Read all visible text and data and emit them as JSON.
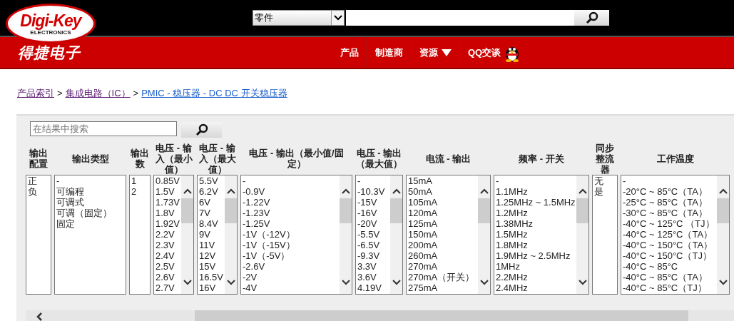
{
  "logo": {
    "brand": "Digi-Key",
    "subtitle": "ELECTRONICS",
    "local_name": "得捷电子"
  },
  "search": {
    "category": "零件"
  },
  "nav": [
    {
      "label": "产品",
      "kind": "plain"
    },
    {
      "label": "制造商",
      "kind": "plain"
    },
    {
      "label": "资源",
      "kind": "dropdown"
    },
    {
      "label": "QQ交谈",
      "kind": "chat"
    }
  ],
  "breadcrumb": [
    {
      "label": "产品索引",
      "visited": true
    },
    {
      "label": "集成电路（IC）",
      "visited": true
    },
    {
      "label": "PMIC - 稳压器 - DC DC 开关稳压器",
      "visited": false
    }
  ],
  "separator": ">",
  "filter": {
    "placeholder": "在结果中搜索"
  },
  "columns": [
    {
      "header": "输出配置",
      "scrollable": false,
      "options": [
        "正",
        "负"
      ]
    },
    {
      "header": "输出类型",
      "scrollable": false,
      "options": [
        "-",
        "可编程",
        "可调式",
        "可调（固定）",
        "固定"
      ]
    },
    {
      "header": "输出数",
      "scrollable": false,
      "options": [
        "1",
        "2"
      ]
    },
    {
      "header": "电压 - 输入（最小值）",
      "scrollable": true,
      "options": [
        "0.85V",
        "1.5V",
        "1.73V",
        "1.8V",
        "1.92V",
        "2.2V",
        "2.3V",
        "2.4V",
        "2.5V",
        "2.6V",
        "2.7V"
      ]
    },
    {
      "header": "电压 - 输入（最大值）",
      "scrollable": true,
      "options": [
        "5.5V",
        "6.2V",
        "6V",
        "7V",
        "8.4V",
        "9V",
        "11V",
        "12V",
        "15V",
        "16.5V",
        "16V"
      ]
    },
    {
      "header": "电压 - 输出（最小值/固定）",
      "scrollable": true,
      "options": [
        "-",
        "-0.9V",
        "-1.22V",
        "-1.23V",
        "-1.25V",
        "-1V（-12V）",
        "-1V（-15V）",
        "-1V（-5V）",
        "-2.6V",
        "-2V",
        "-4V"
      ]
    },
    {
      "header": "电压 - 输出（最大值）",
      "scrollable": true,
      "options": [
        "-",
        "-10.3V",
        "-15V",
        "-16V",
        "-20V",
        "-5.5V",
        "-6.5V",
        "-9.3V",
        "3.3V",
        "3.6V",
        "4.19V"
      ]
    },
    {
      "header": "电流 - 输出",
      "scrollable": true,
      "options": [
        "15mA",
        "50mA",
        "105mA",
        "120mA",
        "125mA",
        "150mA",
        "200mA",
        "260mA",
        "270mA",
        "270mA（开关）",
        "275mA"
      ]
    },
    {
      "header": "频率 - 开关",
      "scrollable": true,
      "options": [
        "-",
        "1.1MHz",
        "1.25MHz ~ 1.5MHz",
        "1.2MHz",
        "1.38MHz",
        "1.5MHz",
        "1.8MHz",
        "1.9MHz ~ 2.5MHz",
        "1MHz",
        "2.2MHz",
        "2.4MHz"
      ]
    },
    {
      "header": "同步整流器",
      "scrollable": false,
      "options": [
        "无",
        "是"
      ]
    },
    {
      "header": "工作温度",
      "scrollable": true,
      "options": [
        "-",
        "-20°C ~ 85°C（TA）",
        "-25°C ~ 85°C（TA）",
        "-30°C ~ 85°C（TA）",
        "-40°C ~ 125°C （TJ）",
        "-40°C ~ 125°C（TA）",
        "-40°C ~ 150°C（TA）",
        "-40°C ~ 150°C（TJ）",
        "-40°C ~ 85°C",
        "-40°C ~ 85°C（TA）",
        "-40°C ~ 85°C（TJ）"
      ]
    }
  ]
}
